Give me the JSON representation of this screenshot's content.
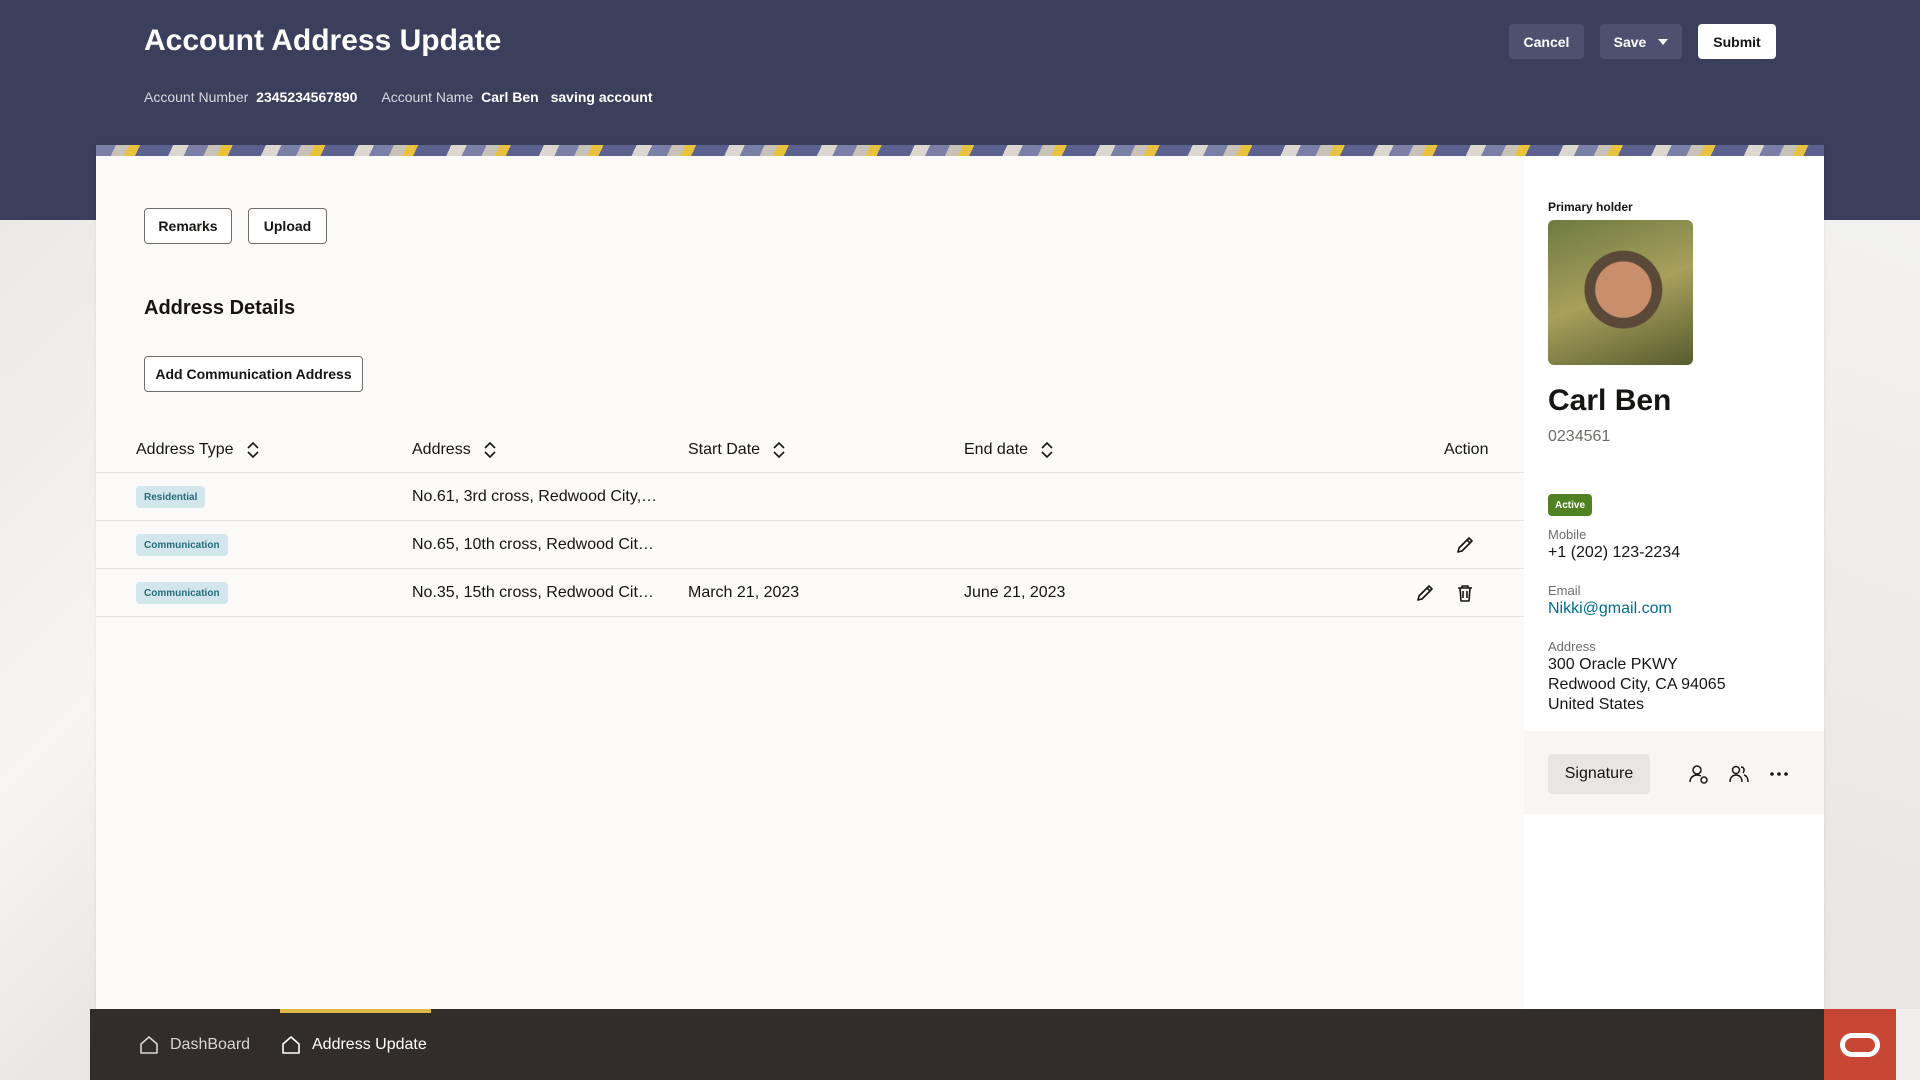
{
  "header": {
    "title": "Account Address Update",
    "account_number_label": "Account Number",
    "account_number": "2345234567890",
    "account_name_label": "Account Name",
    "account_name": "Carl Ben",
    "account_type": "saving account",
    "cancel_label": "Cancel",
    "save_label": "Save",
    "submit_label": "Submit"
  },
  "toolbar": {
    "remarks_label": "Remarks",
    "upload_label": "Upload"
  },
  "section": {
    "title": "Address Details",
    "add_button_label": "Add Communication Address"
  },
  "table": {
    "columns": [
      "Address Type",
      "Address",
      "Start Date",
      "End date",
      "Action"
    ],
    "rows": [
      {
        "type": "Residential",
        "address": "No.61, 3rd cross, Redwood City,…",
        "start": "",
        "end": "",
        "actions": []
      },
      {
        "type": "Communication",
        "address": "No.65, 10th cross, Redwood Cit…",
        "start": "",
        "end": "",
        "actions": [
          "edit"
        ]
      },
      {
        "type": "Communication",
        "address": "No.35, 15th cross, Redwood Cit…",
        "start": "March 21, 2023",
        "end": "June 21, 2023",
        "actions": [
          "edit",
          "delete"
        ]
      }
    ]
  },
  "holder": {
    "section_label": "Primary holder",
    "name": "Carl Ben",
    "id": "0234561",
    "status": "Active",
    "mobile_label": "Mobile",
    "mobile": "+1 (202) 123-2234",
    "email_label": "Email",
    "email": "Nikki@gmail.com",
    "address_label": "Address",
    "address_line1": "300 Oracle PKWY",
    "address_line2": "Redwood City, CA 94065",
    "address_line3": "United States",
    "signature_label": "Signature"
  },
  "footer": {
    "nav": [
      {
        "label": "DashBoard",
        "active": false
      },
      {
        "label": "Address Update",
        "active": true
      }
    ]
  },
  "colors": {
    "header_bg": "#3a3f5c",
    "footer_bg": "#312d2a",
    "accent": "#e0b84a",
    "brand": "#c74634",
    "active_badge": "#508223",
    "type_badge": "#d3e6eb"
  }
}
